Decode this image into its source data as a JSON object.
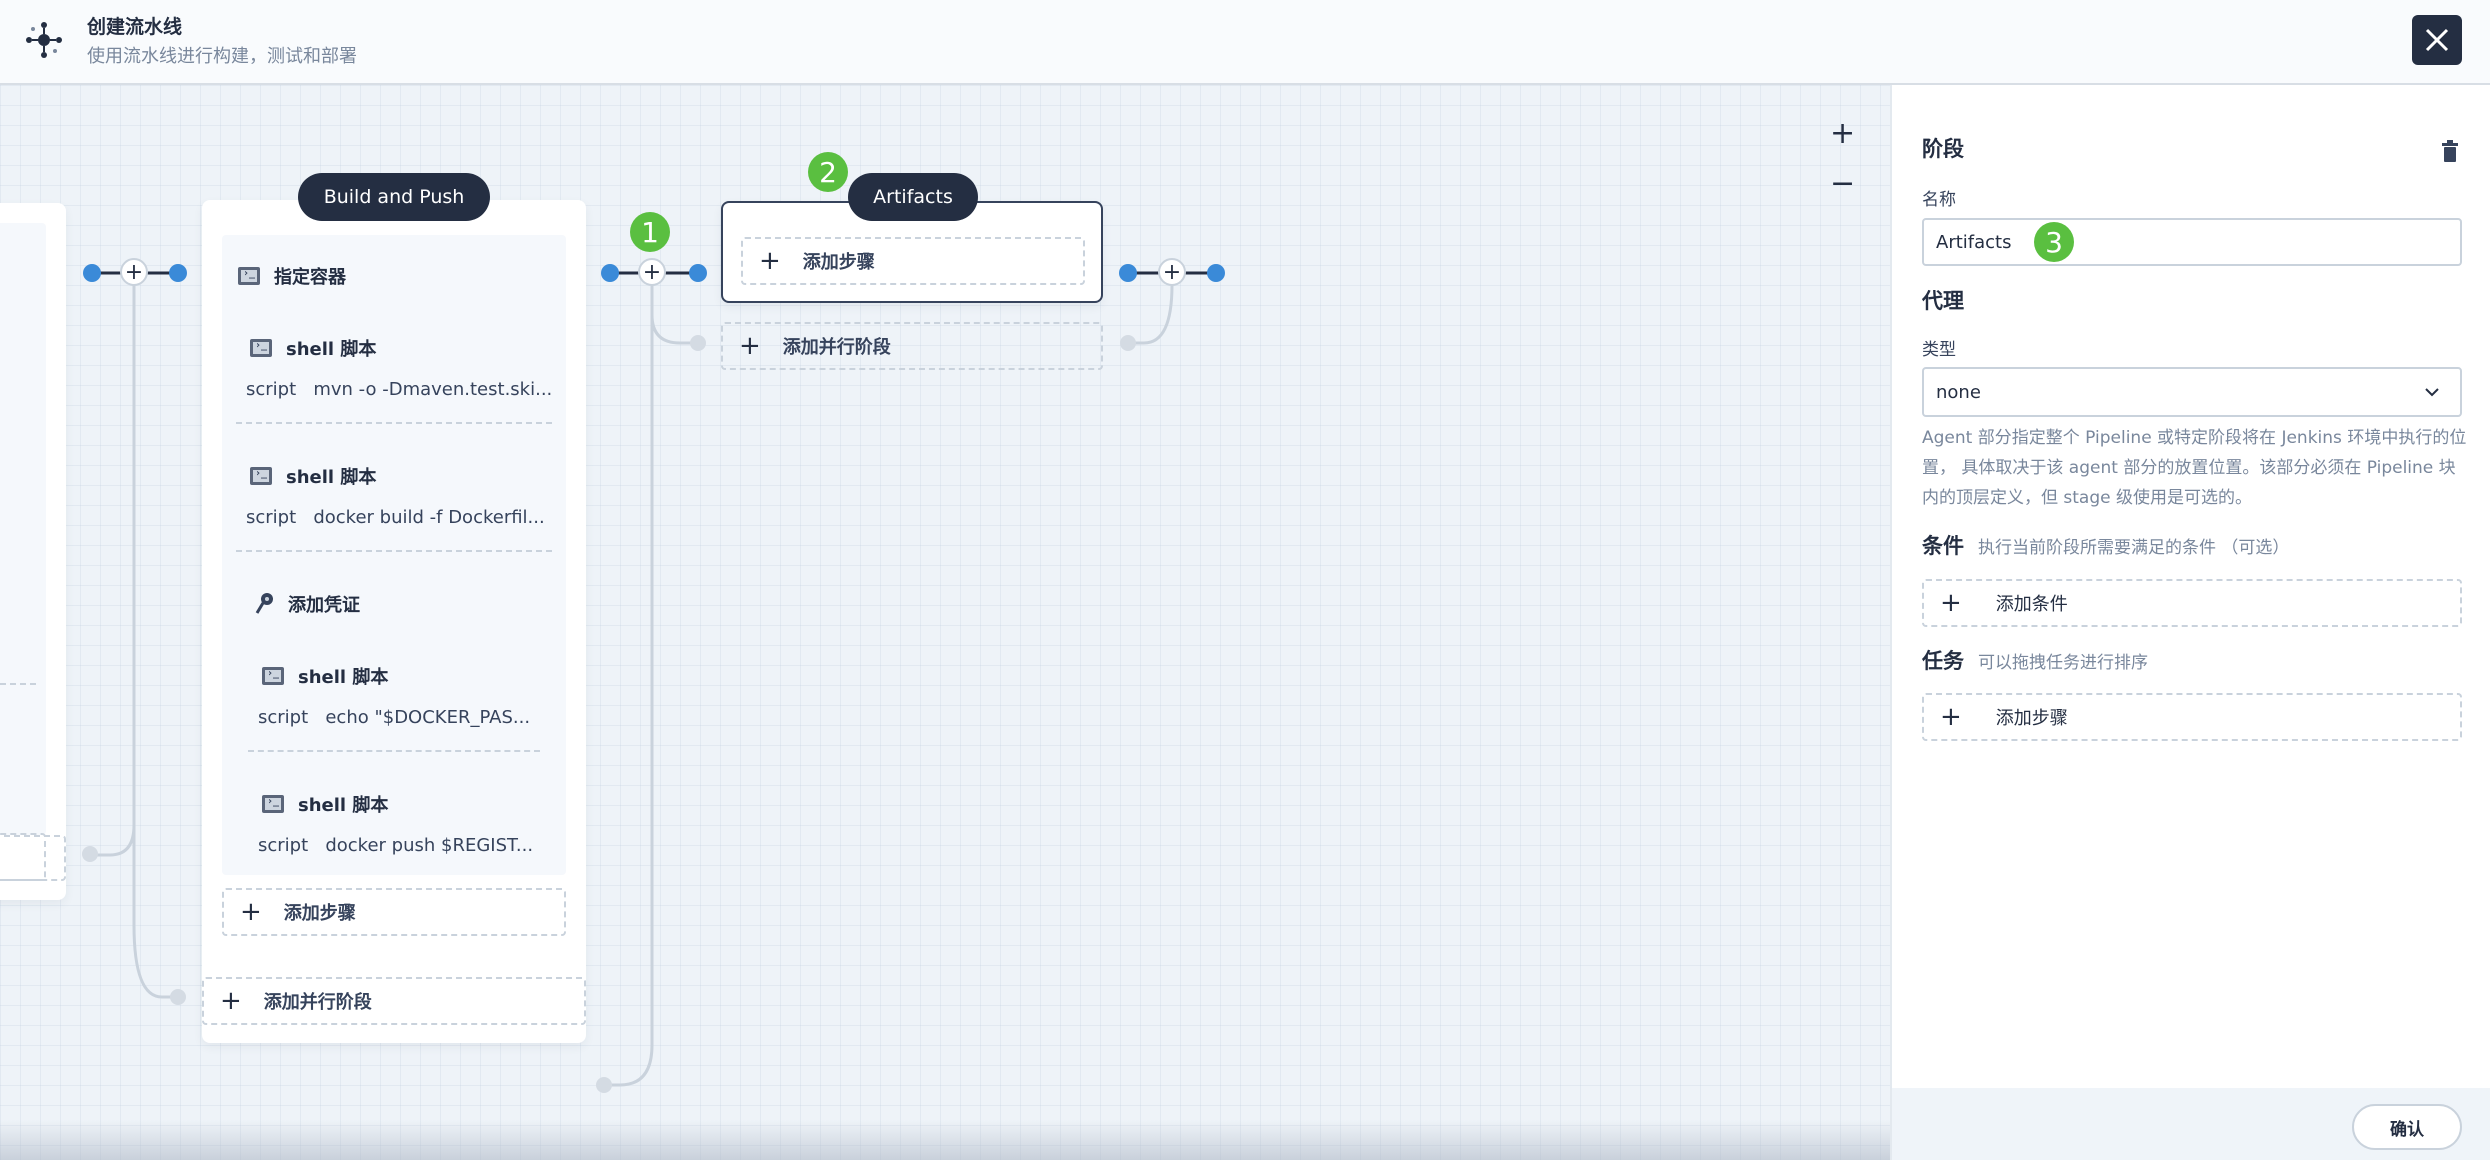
{
  "header": {
    "title": "创建流水线",
    "subtitle": "使用流水线进行构建，测试和部署"
  },
  "canvas": {
    "stage_build": {
      "name": "Build and Push",
      "steps": [
        {
          "type": "container",
          "title": "指定容器"
        },
        {
          "type": "shell",
          "title": "shell 脚本",
          "script_label": "script",
          "script": "mvn -o -Dmaven.test.ski..."
        },
        {
          "type": "shell",
          "title": "shell 脚本",
          "script_label": "script",
          "script": "docker build -f Dockerfil..."
        },
        {
          "type": "credential",
          "title": "添加凭证"
        },
        {
          "type": "shell",
          "title": "shell 脚本",
          "script_label": "script",
          "script": "echo \"$DOCKER_PAS..."
        },
        {
          "type": "shell",
          "title": "shell 脚本",
          "script_label": "script",
          "script": "docker push $REGIST..."
        }
      ],
      "add_step_label": "添加步骤",
      "add_parallel_label": "添加并行阶段"
    },
    "stage_artifacts": {
      "name": "Artifacts",
      "add_step_label": "添加步骤",
      "add_parallel_label": "添加并行阶段"
    },
    "badges": [
      "1",
      "2",
      "3"
    ],
    "zoom_in": "+",
    "zoom_out": "−"
  },
  "panel": {
    "stage_heading": "阶段",
    "name_label": "名称",
    "name_value": "Artifacts",
    "agent_heading": "代理",
    "type_label": "类型",
    "type_value": "none",
    "agent_description": "Agent 部分指定整个 Pipeline 或特定阶段将在 Jenkins 环境中执行的位置， 具体取决于该 agent 部分的放置位置。该部分必须在 Pipeline 块内的顶层定义，但 stage 级使用是可选的。",
    "condition_heading": "条件",
    "condition_hint": "执行当前阶段所需要满足的条件 （可选）",
    "add_condition_label": "添加条件",
    "task_heading": "任务",
    "task_hint": "可以拖拽任务进行排序",
    "add_step_label": "添加步骤",
    "confirm_label": "确认"
  },
  "colors": {
    "dark": "#242e42",
    "badge_green": "#5abf40",
    "connector_blue": "#3a8ad8",
    "connector_grey": "#c9d2dc"
  }
}
